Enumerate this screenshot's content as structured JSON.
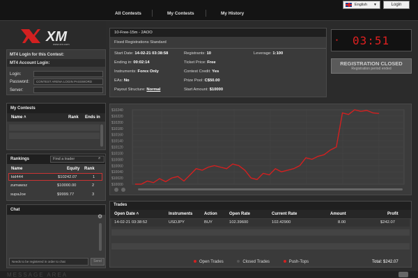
{
  "header": {
    "nav": [
      "All Contests",
      "My Contests",
      "My History"
    ],
    "language": "English",
    "login_label": "Login"
  },
  "brand": {
    "logo_text": "XM",
    "logo_sub": "www.xm.com"
  },
  "left_login": {
    "title": "MT4 Login for this Contest:",
    "account_title": "MT4 Account Login:",
    "login_label": "Login:",
    "password_label": "Password:",
    "password_value": "CONTEST ARENA LOGIN PASSWORD",
    "server_label": "Server:"
  },
  "contest": {
    "title": "10-Free-15m - 2AOO",
    "subtitle": "Fixed Registrations Standard",
    "start_date_label": "Start Date:",
    "start_date": "14-02-21 03:38:58",
    "ending_label": "Ending in:",
    "ending": "00:02:14",
    "instruments_label": "Instruments:",
    "instruments": "Forex Only",
    "eas_label": "EAs:",
    "eas": "No",
    "payout_label": "Payout Structure:",
    "payout": "Normal",
    "registrants_label": "Registrants:",
    "registrants": "10",
    "ticket_label": "Ticket Price:",
    "ticket": "Free",
    "credit_label": "Contest Credit:",
    "credit": "Yes",
    "prize_label": "Prize Pool:",
    "prize": "C$50.00",
    "start_amount_label": "Start Amount:",
    "start_amount": "$10000",
    "leverage_label": "Leverage:",
    "leverage": "1:100"
  },
  "timer": {
    "display": "03:51"
  },
  "registration": {
    "status": "REGISTRATION CLOSED",
    "sub": "Registration period ended"
  },
  "my_contests": {
    "title": "My Contests",
    "cols": [
      "Name",
      "Rank",
      "Ends in"
    ]
  },
  "rankings": {
    "title": "Rankings",
    "search_placeholder": "Find a trader",
    "cols": [
      "Name",
      "Equity",
      "Rank"
    ],
    "rows": [
      {
        "name": "kid444",
        "equity": "$10242.07",
        "rank": "1"
      },
      {
        "name": "zumawsz",
        "equity": "$10000.00",
        "rank": "2"
      },
      {
        "name": "supaJoe",
        "equity": "$9999.77",
        "rank": "3"
      }
    ]
  },
  "chat": {
    "title": "Chat",
    "input_placeholder": "Needs to be registered in order to chat",
    "send_label": "Send"
  },
  "chart_data": {
    "type": "line",
    "ytick_labels": [
      "$10240",
      "$10220",
      "$10200",
      "$10180",
      "$10160",
      "$10140",
      "$10120",
      "$10100",
      "$10080",
      "$10060",
      "$10040",
      "$10020",
      "$10000"
    ],
    "ylim": [
      10000,
      10240
    ],
    "xtick_labels": [
      "",
      "",
      "",
      "",
      "",
      "",
      "",
      ""
    ],
    "values": [
      10000,
      10000,
      10010,
      10005,
      10018,
      10008,
      10020,
      10025,
      10010,
      10030,
      10050,
      10045,
      10055,
      10060,
      10055,
      10050,
      10065,
      10060,
      10045,
      10020,
      10015,
      10035,
      10030,
      10050,
      10040,
      10045,
      10050,
      10060,
      10085,
      10080,
      10090,
      10095,
      10110,
      10120,
      10230,
      10225,
      10240,
      10235,
      10238,
      10230,
      10228
    ]
  },
  "trades": {
    "title": "Trades",
    "cols": [
      "Open Date",
      "Instruments",
      "Action",
      "Open Rate",
      "Current Rate",
      "Amount",
      "Profit"
    ],
    "rows": [
      {
        "open_date": "14-02-21 03:38:52",
        "instrument": "USDJPY",
        "action": "BUY",
        "open_rate": "102.39600",
        "current_rate": "102.42900",
        "amount": "8.00",
        "profit": "$242.07"
      }
    ],
    "legend": [
      "Open Trades",
      "Closed Trades",
      "Push-Tops"
    ],
    "total_label": "Total:",
    "total": "$242.07"
  },
  "footer": {
    "text": "MESSAGE AREA"
  }
}
